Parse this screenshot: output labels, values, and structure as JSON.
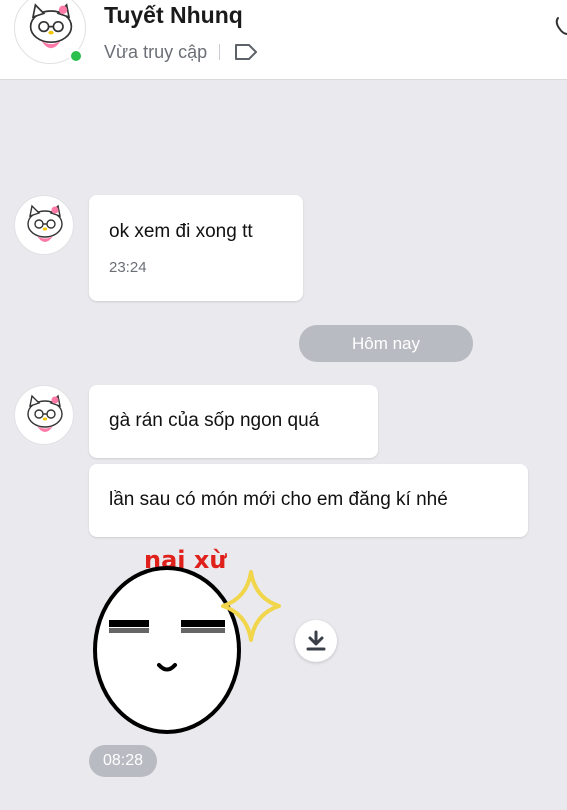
{
  "header": {
    "contact_name": "Tuyết Nhunq",
    "status": "Vừa truy cập",
    "online_color": "#2bbf4d",
    "icons": [
      "avatar-kitty",
      "online-dot",
      "tag-icon",
      "phone-icon"
    ]
  },
  "messages": [
    {
      "text": "ok xem đi xong tt",
      "time": "23:24"
    },
    {
      "text": "gà rán của sốp ngon quá"
    },
    {
      "text": "lần sau có món mới cho em đăng kí nhé"
    }
  ],
  "date_divider": "Hôm nay",
  "sticker": {
    "caption": "nai xừ",
    "time": "08:28"
  },
  "colors": {
    "background": "#eaeaee",
    "bubble": "#ffffff",
    "pill": "#b9bbc3",
    "sticker_caption": "#e0201b"
  }
}
